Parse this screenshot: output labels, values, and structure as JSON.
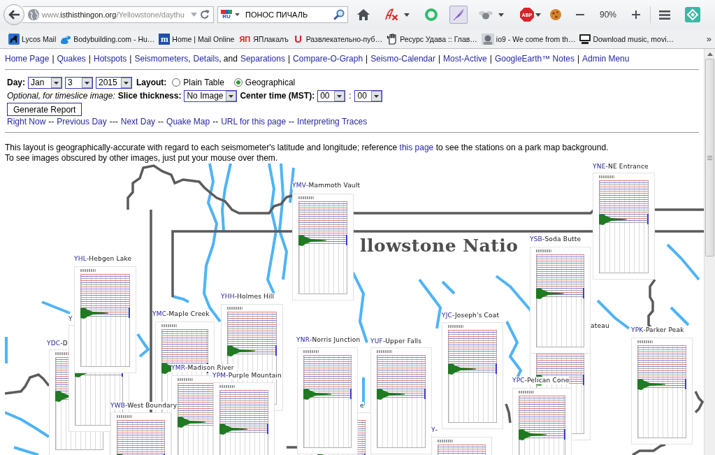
{
  "browser": {
    "url": {
      "prefix": "www.",
      "host": "isthisthingon.org",
      "path": "/Yellowstone/daythu"
    },
    "search": {
      "language": "RU",
      "query": "ПОНОС ПИЧАЛЬ"
    },
    "adblock": "ABP",
    "zoom": "90%",
    "bookmarks": [
      {
        "label": "Lycos Mail"
      },
      {
        "label": "Bodybuilding.com - Hu…"
      },
      {
        "label": "Home | Mail Online",
        "icon_text": "m"
      },
      {
        "label": "ЯПлакалъ",
        "icon_text": "ЯП"
      },
      {
        "label": "Развлекательно-пуб…",
        "icon_text": "U"
      },
      {
        "label": "Ресурс Удава :: Глав…"
      },
      {
        "label": "io9 - We come from th…"
      },
      {
        "label": "Download music, movi…"
      }
    ],
    "more": "»"
  },
  "nav": [
    {
      "kind": "link",
      "text": "Home Page"
    },
    {
      "kind": "sep",
      "text": "|"
    },
    {
      "kind": "link",
      "text": "Quakes"
    },
    {
      "kind": "sep",
      "text": "|"
    },
    {
      "kind": "link",
      "text": "Hotspots"
    },
    {
      "kind": "sep",
      "text": "|"
    },
    {
      "kind": "link",
      "text": "Seismometers"
    },
    {
      "kind": "joint",
      "text": ","
    },
    {
      "kind": "link",
      "text": "Details"
    },
    {
      "kind": "joint",
      "text": ", and"
    },
    {
      "kind": "link",
      "text": "Separations"
    },
    {
      "kind": "sep",
      "text": "|"
    },
    {
      "kind": "link",
      "text": "Compare-O-Graph"
    },
    {
      "kind": "sep",
      "text": "|"
    },
    {
      "kind": "link",
      "text": "Seismo-Calendar"
    },
    {
      "kind": "sep",
      "text": "|"
    },
    {
      "kind": "link",
      "text": "Most-Active"
    },
    {
      "kind": "sep",
      "text": "|"
    },
    {
      "kind": "link",
      "text": "GoogleEarth™ Notes"
    },
    {
      "kind": "sep",
      "text": "|"
    },
    {
      "kind": "link",
      "text": "Admin Menu"
    }
  ],
  "form": {
    "day_label": "Day:",
    "day": [
      "Jan",
      "3",
      "2015"
    ],
    "layout_label": "Layout:",
    "layout": [
      {
        "label": "Plain Table",
        "selected": false
      },
      {
        "label": "Geographical",
        "selected": true
      }
    ],
    "note": "Optional, for timeslice image:",
    "thickness_label": "Slice thickness:",
    "thickness": "No Image",
    "center_label": "Center time (MST):",
    "hour": "00",
    "colon": ":",
    "minute": "00",
    "submit": "Generate Report"
  },
  "links": [
    {
      "kind": "link",
      "text": "Right Now"
    },
    {
      "kind": "sep",
      "text": "--"
    },
    {
      "kind": "link",
      "text": "Previous Day"
    },
    {
      "kind": "sep",
      "text": "---"
    },
    {
      "kind": "link",
      "text": "Next Day"
    },
    {
      "kind": "sep",
      "text": "--"
    },
    {
      "kind": "link",
      "text": "Quake Map"
    },
    {
      "kind": "sep",
      "text": "--"
    },
    {
      "kind": "link",
      "text": "URL for this page"
    },
    {
      "kind": "sep",
      "text": "--"
    },
    {
      "kind": "link",
      "text": "Interpreting Traces"
    }
  ],
  "intro": {
    "before": "This layout is geographically-accurate with regard to each seismometer's latitude and longitude; reference ",
    "link": "this page",
    "after": " to see the stations on a park map background."
  },
  "hint": "To see images obscured by other images, just put your mouse over them.",
  "map": {
    "title": "llowstone Natio",
    "stations": [
      {
        "code": "YNE",
        "name": "-NE Entrance"
      },
      {
        "code": "YMV",
        "name": "-Mammoth Vault"
      },
      {
        "code": "YSB",
        "name": "-Soda Butte"
      },
      {
        "code": "YHL",
        "name": "-Hebgen Lake"
      },
      {
        "code": "YHH",
        "name": "-Holmes Hill"
      },
      {
        "code": "Y"
      },
      {
        "code": "YMC",
        "name": "-Maple Creek"
      },
      {
        "code": "YJC",
        "name": "-Joseph's Coat"
      },
      {
        "name": "ateau"
      },
      {
        "code": "YPK",
        "name": "-Parker Peak"
      },
      {
        "code": "YDC",
        "name": "-D"
      },
      {
        "code": "YNR",
        "name": "-Norris Junction"
      },
      {
        "code": "YUF",
        "name": "-Upper Falls"
      },
      {
        "code": "YMR",
        "name": "-Madison River"
      },
      {
        "code": "YPM",
        "name": "-Purple Mountain"
      },
      {
        "code": "YPC",
        "name": "-Pelican Cone"
      },
      {
        "code": "YWB",
        "name": "-West Boundary"
      },
      {
        "name": "e"
      },
      {
        "code": "Y",
        "name": "-"
      }
    ]
  }
}
